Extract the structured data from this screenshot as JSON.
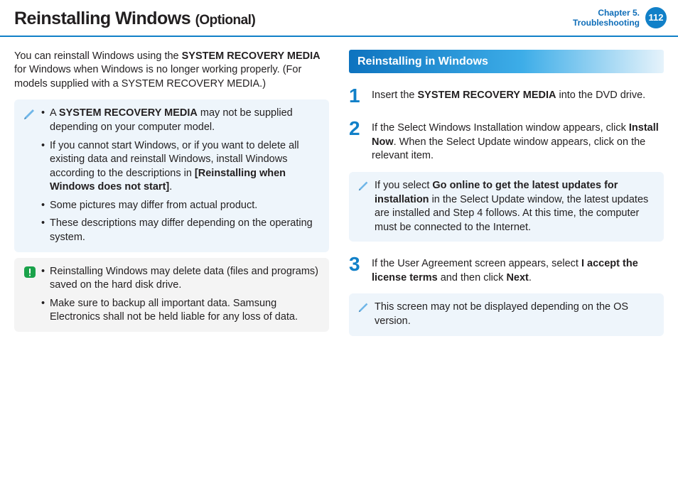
{
  "header": {
    "title_main": "Reinstalling Windows",
    "title_optional": "(Optional)",
    "chapter_line1": "Chapter 5.",
    "chapter_line2": "Troubleshooting",
    "page_number": "112"
  },
  "left": {
    "intro_parts": {
      "p1": "You can reinstall Windows using the ",
      "b1": "SYSTEM RECOVERY MEDIA",
      "p2": " for Windows when Windows is no longer working properly. (For models supplied with a SYSTEM RECOVERY MEDIA.)"
    },
    "note_items": {
      "i1a": "A ",
      "i1b": "SYSTEM RECOVERY MEDIA",
      "i1c": " may not be supplied depending on your computer model.",
      "i2a": "If you cannot start Windows, or if you want to delete all existing data and reinstall Windows, install Windows according to the descriptions in ",
      "i2b": "[Reinstalling when Windows does not start]",
      "i2c": ".",
      "i3": "Some pictures may differ from actual product.",
      "i4": "These descriptions may differ depending on the operating system."
    },
    "warn_items": {
      "w1": "Reinstalling Windows may delete data (files and programs) saved on the hard disk drive.",
      "w2": "Make sure to backup all important data. Samsung Electronics shall not be held liable for any loss of data."
    }
  },
  "right": {
    "section_title": "Reinstalling in Windows",
    "step1": {
      "num": "1",
      "a": "Insert the ",
      "b": "SYSTEM RECOVERY MEDIA",
      "c": " into the DVD drive."
    },
    "step2": {
      "num": "2",
      "a": "If the Select Windows Installation window appears, click ",
      "b": "Install Now",
      "c": ". When the Select Update window appears, click on the relevant item."
    },
    "note2": {
      "a": "If you select ",
      "b": "Go online to get the latest updates for installation",
      "c": " in the Select Update window, the latest updates are installed and Step 4 follows. At this time, the computer must be connected to the Internet."
    },
    "step3": {
      "num": "3",
      "a": "If the User Agreement screen appears, select ",
      "b": "I accept the license terms",
      "c": " and then click ",
      "d": "Next",
      "e": "."
    },
    "note3": "This screen may not be displayed depending on the OS version."
  }
}
